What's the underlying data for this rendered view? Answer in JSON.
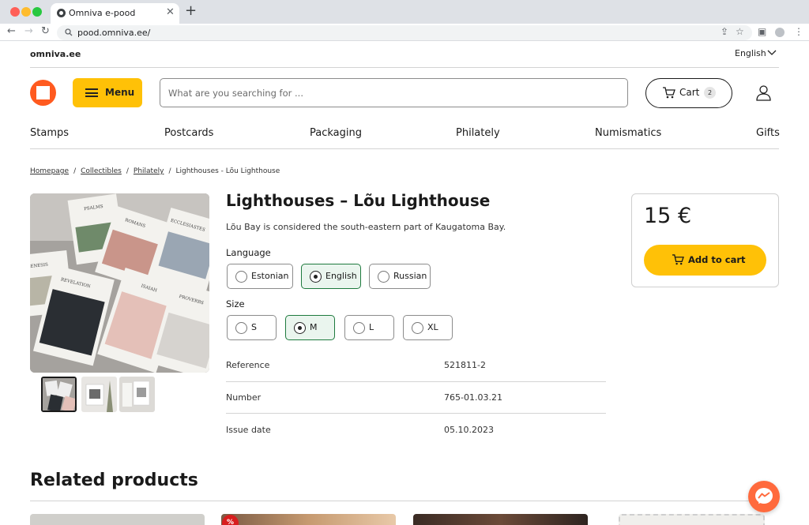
{
  "browser": {
    "tab_title": "Omniva e-pood",
    "url": "pood.omniva.ee/"
  },
  "top_bar": {
    "site_link": "omniva.ee",
    "language": "English"
  },
  "header": {
    "menu_label": "Menu",
    "search_placeholder": "What are you searching for ...",
    "cart_label": "Cart",
    "cart_count": "2"
  },
  "categories": [
    "Stamps",
    "Postcards",
    "Packaging",
    "Philately",
    "Numismatics",
    "Gifts"
  ],
  "breadcrumb": {
    "items": [
      "Homepage",
      "Collectibles",
      "Philately"
    ],
    "separator": "/",
    "current": "Lighthouses - Lõu Lighthouse"
  },
  "product": {
    "title": "Lighthouses – Lõu Lighthouse",
    "description": "Lõu Bay is considered the south-eastern part of Kaugatoma Bay.",
    "language_label": "Language",
    "languages": [
      "Estonian",
      "English",
      "Russian"
    ],
    "selected_language": "English",
    "size_label": "Size",
    "sizes": [
      "S",
      "M",
      "L",
      "XL"
    ],
    "selected_size": "M",
    "specs": [
      {
        "label": "Reference",
        "value": "521811-2"
      },
      {
        "label": "Number",
        "value": "765-01.03.21"
      },
      {
        "label": "Issue date",
        "value": "05.10.2023"
      }
    ],
    "price": "15 €",
    "add_to_cart": "Add to cart"
  },
  "gallery": {
    "book_titles": [
      "PSALMS",
      "ROMANS",
      "ECCLESIASTES",
      "GENESIS",
      "REVELATION",
      "ISAIAH",
      "PROVERBS"
    ]
  },
  "related": {
    "title": "Related products",
    "discount_badge": "%"
  },
  "colors": {
    "accent_yellow": "#ffc107",
    "logo_orange": "#ff5a1f",
    "selected_green": "#1e7a3e",
    "badge_red": "#d81e1e"
  },
  "icons": [
    "search-icon",
    "cart-icon",
    "user-icon",
    "chevron-down-icon",
    "menu-icon",
    "messenger-icon"
  ]
}
